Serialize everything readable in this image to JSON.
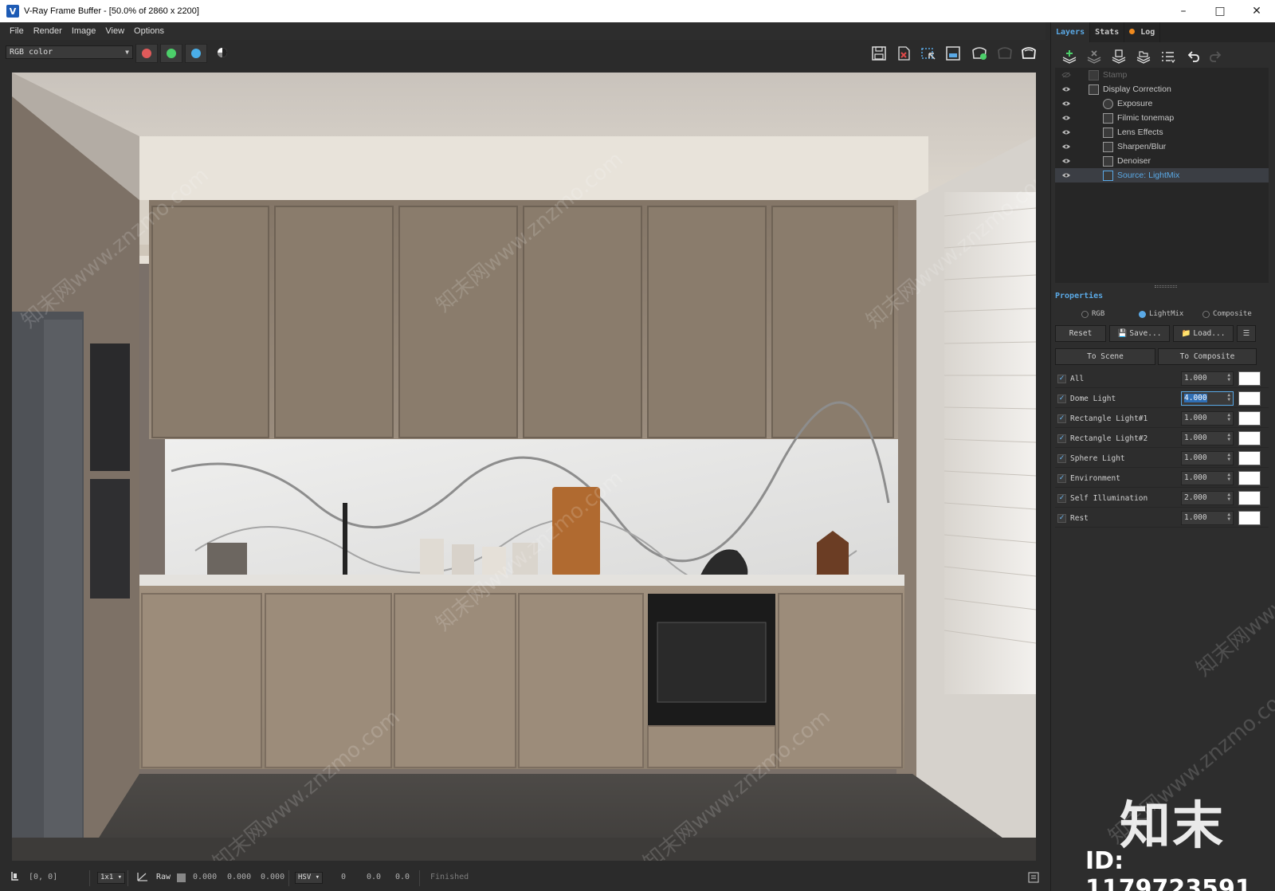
{
  "window": {
    "title": "V-Ray Frame Buffer - [50.0% of 2860 x 2200]",
    "controls": [
      "minimize-icon",
      "maximize-icon",
      "close-icon"
    ]
  },
  "menu": [
    "File",
    "Render",
    "Image",
    "View",
    "Options"
  ],
  "toolbar": {
    "channel": "RGB color",
    "channel_buttons": [
      {
        "name": "red-channel",
        "color": "#e05a5a"
      },
      {
        "name": "green-channel",
        "color": "#4ccf6a"
      },
      {
        "name": "blue-channel",
        "color": "#4aaee8"
      }
    ],
    "right_icons": [
      "save-icon",
      "clear-image-icon",
      "region-render-icon",
      "track-mouse-icon",
      "interactive-render-icon",
      "render-last-icon",
      "render-icon"
    ]
  },
  "status": {
    "coords": "[0, 0]",
    "zoom": "1x1",
    "raw_label": "Raw",
    "values": [
      "0.000",
      "0.000",
      "0.000"
    ],
    "color_mode": "HSV",
    "hsv_values": [
      "0",
      "0.0",
      "0.0"
    ],
    "state": "Finished"
  },
  "panel": {
    "tabs": [
      "Layers",
      "Stats",
      "Log"
    ],
    "layer_tools": [
      "add-layer-icon",
      "delete-layer-icon",
      "save-layers-icon",
      "load-layers-icon",
      "layer-list-icon",
      "undo-icon",
      "redo-icon"
    ],
    "layers": [
      {
        "name": "Stamp",
        "indent": 0,
        "visible": false
      },
      {
        "name": "Display Correction",
        "indent": 0,
        "visible": true
      },
      {
        "name": "Exposure",
        "indent": 1,
        "visible": true
      },
      {
        "name": "Filmic tonemap",
        "indent": 1,
        "visible": true
      },
      {
        "name": "Lens Effects",
        "indent": 1,
        "visible": true
      },
      {
        "name": "Sharpen/Blur",
        "indent": 1,
        "visible": true
      },
      {
        "name": "Denoiser",
        "indent": 1,
        "visible": true
      },
      {
        "name": "Source: LightMix",
        "indent": 1,
        "visible": true,
        "selected": true
      }
    ],
    "properties_title": "Properties",
    "modes": [
      {
        "label": "RGB",
        "selected": false
      },
      {
        "label": "LightMix",
        "selected": true
      },
      {
        "label": "Composite",
        "selected": false
      }
    ],
    "buttons": {
      "reset": "Reset",
      "save": "Save...",
      "load": "Load...",
      "to_scene": "To Scene",
      "to_composite": "To Composite"
    },
    "lights": [
      {
        "name": "All",
        "value": "1.000",
        "checked": true
      },
      {
        "name": "Dome Light",
        "value": "4.000",
        "checked": true,
        "focused": true
      },
      {
        "name": "Rectangle Light#1",
        "value": "1.000",
        "checked": true
      },
      {
        "name": "Rectangle Light#2",
        "value": "1.000",
        "checked": true
      },
      {
        "name": "Sphere Light",
        "value": "1.000",
        "checked": true
      },
      {
        "name": "Environment",
        "value": "1.000",
        "checked": true
      },
      {
        "name": "Self Illumination",
        "value": "2.000",
        "checked": true
      },
      {
        "name": "Rest",
        "value": "1.000",
        "checked": true
      }
    ]
  },
  "overlay": {
    "watermark": "知末网www.znzmo.com",
    "brand": "知末",
    "id": "ID: 1179723591"
  },
  "colors": {
    "accent": "#5aa9e6",
    "log_dot": "#f08a1e"
  }
}
